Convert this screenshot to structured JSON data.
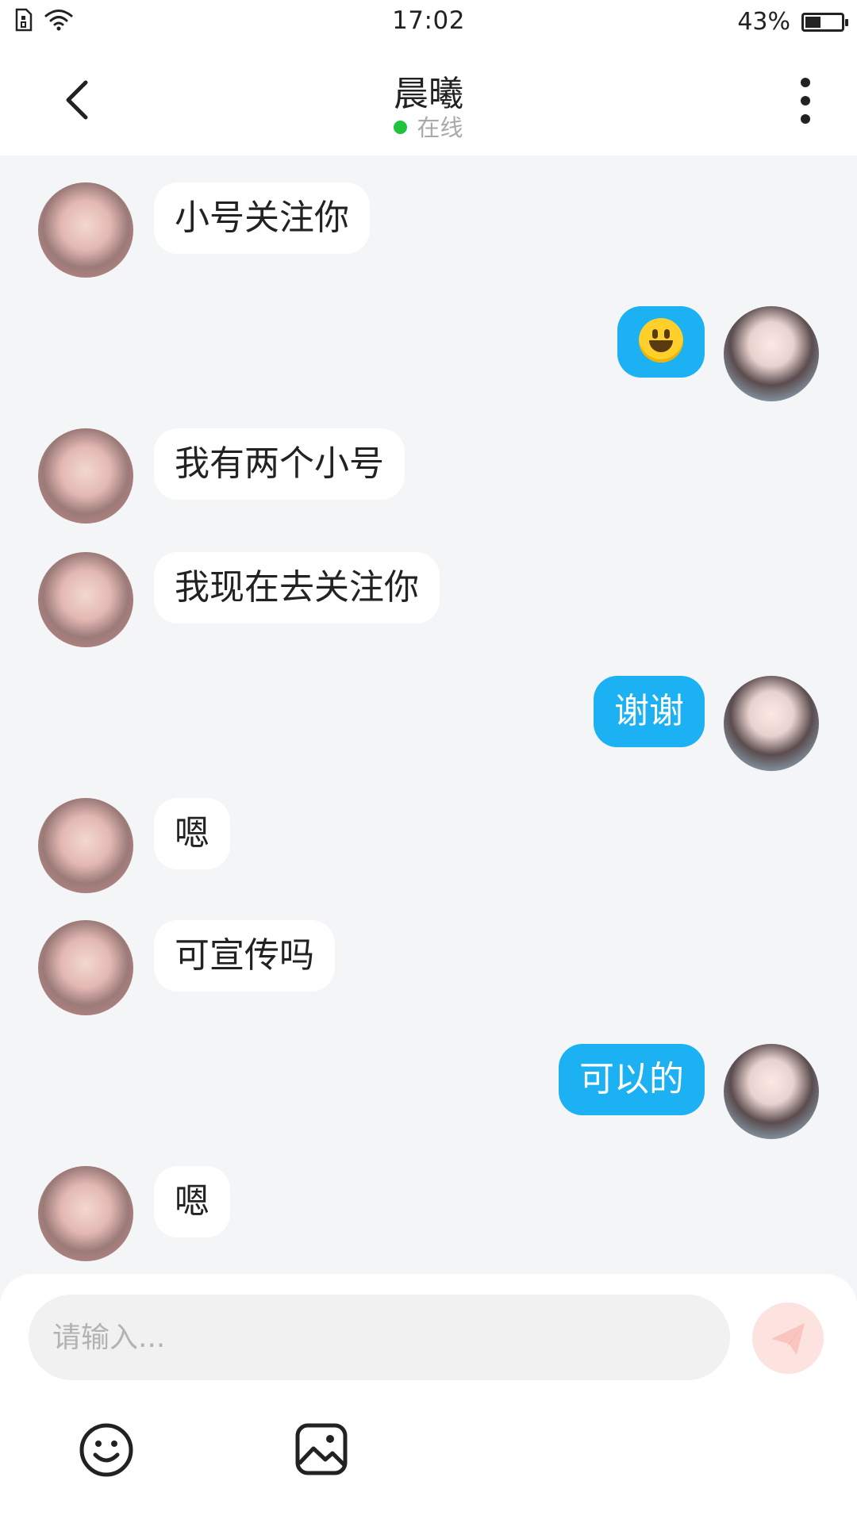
{
  "status_bar": {
    "time": "17:02",
    "battery_text": "43%",
    "battery_level": 0.43,
    "icons": [
      "sim-card-icon",
      "wifi-icon",
      "battery-icon"
    ]
  },
  "header": {
    "back_icon": "chevron-left-icon",
    "title": "晨曦",
    "status": "在线",
    "status_color": "#20c33c",
    "more_icon": "more-vertical-icon"
  },
  "messages": [
    {
      "side": "in",
      "text": "小号关注你"
    },
    {
      "side": "out",
      "emoji": "smiley-emoji",
      "text": ""
    },
    {
      "side": "in",
      "text": "我有两个小号"
    },
    {
      "side": "in",
      "text": "我现在去关注你"
    },
    {
      "side": "out",
      "text": "谢谢"
    },
    {
      "side": "in",
      "text": "嗯"
    },
    {
      "side": "in",
      "text": "可宣传吗"
    },
    {
      "side": "out",
      "text": "可以的"
    },
    {
      "side": "in",
      "text": "嗯"
    }
  ],
  "composer": {
    "placeholder": "请输入...",
    "send_icon": "send-icon",
    "emoji_tool_icon": "emoji-icon",
    "image_tool_icon": "image-icon"
  },
  "colors": {
    "outgoing_bubble": "#1cb1f2",
    "incoming_bubble": "#ffffff",
    "chat_background": "#f4f5f7",
    "send_button": "#fde3e0"
  }
}
